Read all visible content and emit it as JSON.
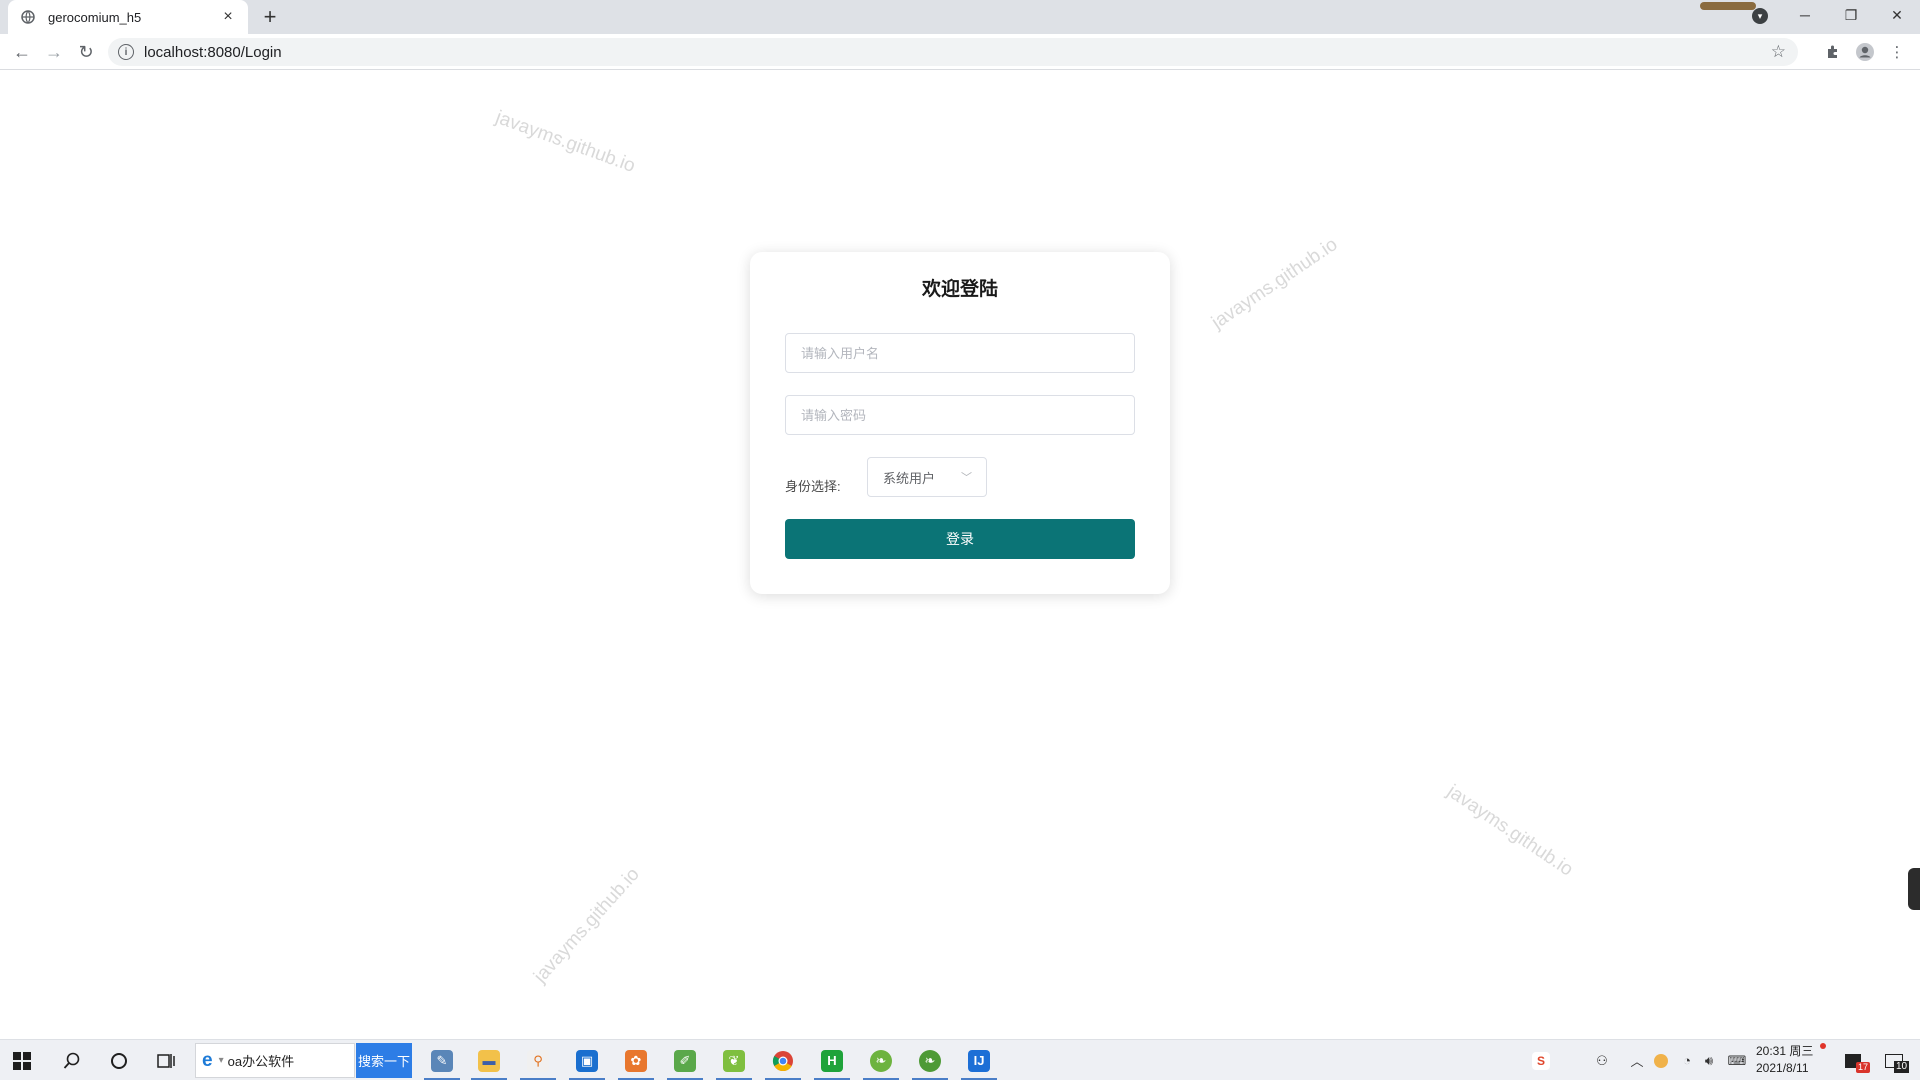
{
  "browser": {
    "tab_title": "gerocomium_h5",
    "tab_close": "×",
    "new_tab": "+",
    "url": "localhost:8080/Login",
    "window_controls": {
      "minimize": "─",
      "restore": "❐",
      "close": "✕"
    },
    "nav": {
      "back": "←",
      "forward": "→",
      "reload": "↻"
    }
  },
  "watermark_text": "javayms.github.io",
  "login": {
    "title": "欢迎登陆",
    "username_placeholder": "请输入用户名",
    "password_placeholder": "请输入密码",
    "role_label": "身份选择:",
    "role_value": "系统用户",
    "submit_label": "登录"
  },
  "taskbar": {
    "search_text": "oa办公软件",
    "search_button": "搜索一下",
    "clock_time": "20:31 周三",
    "clock_date": "2021/8/11",
    "notification_badge": "17",
    "action_center_count": "10",
    "pinned_apps": [
      "file-explorer-icon",
      "search-app-icon",
      "meeting-app-icon",
      "settings-app-icon",
      "notepad-app-icon",
      "leaf-app-icon",
      "chrome-icon",
      "hbuilder-icon",
      "spring-icon",
      "spring-tool-icon",
      "intellij-icon"
    ]
  },
  "colors": {
    "accent": "#0b7476",
    "tabstrip": "#dee1e6",
    "taskbar": "#eef0f4"
  }
}
